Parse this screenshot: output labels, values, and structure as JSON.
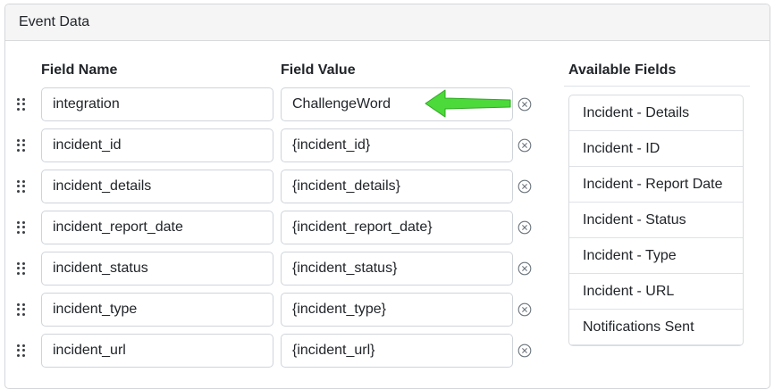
{
  "panel": {
    "title": "Event Data"
  },
  "columns": {
    "field_name": "Field Name",
    "field_value": "Field Value"
  },
  "rows": [
    {
      "name": "integration",
      "value": "ChallengeWord"
    },
    {
      "name": "incident_id",
      "value": "{incident_id}"
    },
    {
      "name": "incident_details",
      "value": "{incident_details}"
    },
    {
      "name": "incident_report_date",
      "value": "{incident_report_date}"
    },
    {
      "name": "incident_status",
      "value": "{incident_status}"
    },
    {
      "name": "incident_type",
      "value": "{incident_type}"
    },
    {
      "name": "incident_url",
      "value": "{incident_url}"
    }
  ],
  "available_fields": {
    "title": "Available Fields",
    "items": [
      "Incident - Details",
      "Incident - ID",
      "Incident - Report Date",
      "Incident - Status",
      "Incident - Type",
      "Incident - URL",
      "Notifications Sent"
    ]
  },
  "icons": {
    "drag": "drag-handle-icon",
    "remove": "circle-x-icon",
    "annotation": "green-arrow-icon"
  },
  "colors": {
    "arrow": "#4cd93a",
    "header_bg": "#f5f5f6",
    "border": "#ced4da"
  }
}
